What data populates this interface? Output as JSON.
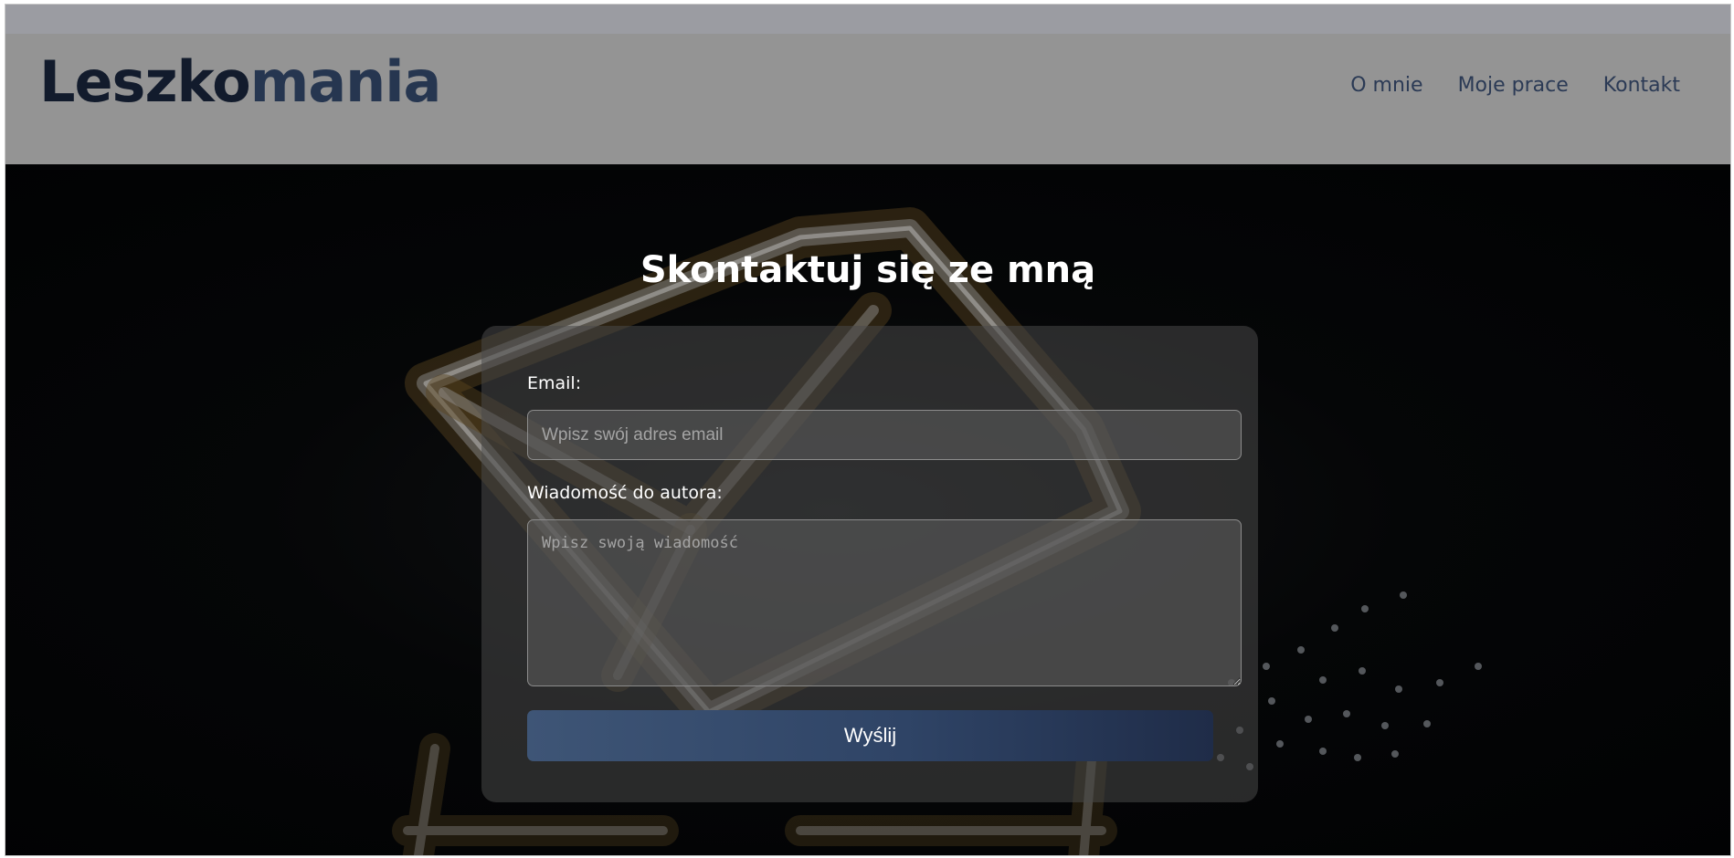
{
  "header": {
    "logo_primary": "Leszko",
    "logo_accent": "mania",
    "nav": [
      {
        "label": "O mnie"
      },
      {
        "label": "Moje prace"
      },
      {
        "label": "Kontakt"
      }
    ]
  },
  "contact": {
    "title": "Skontaktuj się ze mną",
    "email_label": "Email:",
    "email_placeholder": "Wpisz swój adres email",
    "email_value": "",
    "message_label": "Wiadomość do autora:",
    "message_placeholder": "Wpisz swoją wiadomość",
    "message_value": "",
    "submit_label": "Wyślij"
  },
  "colors": {
    "header_bg": "#949494",
    "logo_dark": "#121b2c",
    "logo_accent": "#263650",
    "nav_text": "#2b3a55",
    "button_start": "#3e5576",
    "button_end": "#1f2c48"
  }
}
